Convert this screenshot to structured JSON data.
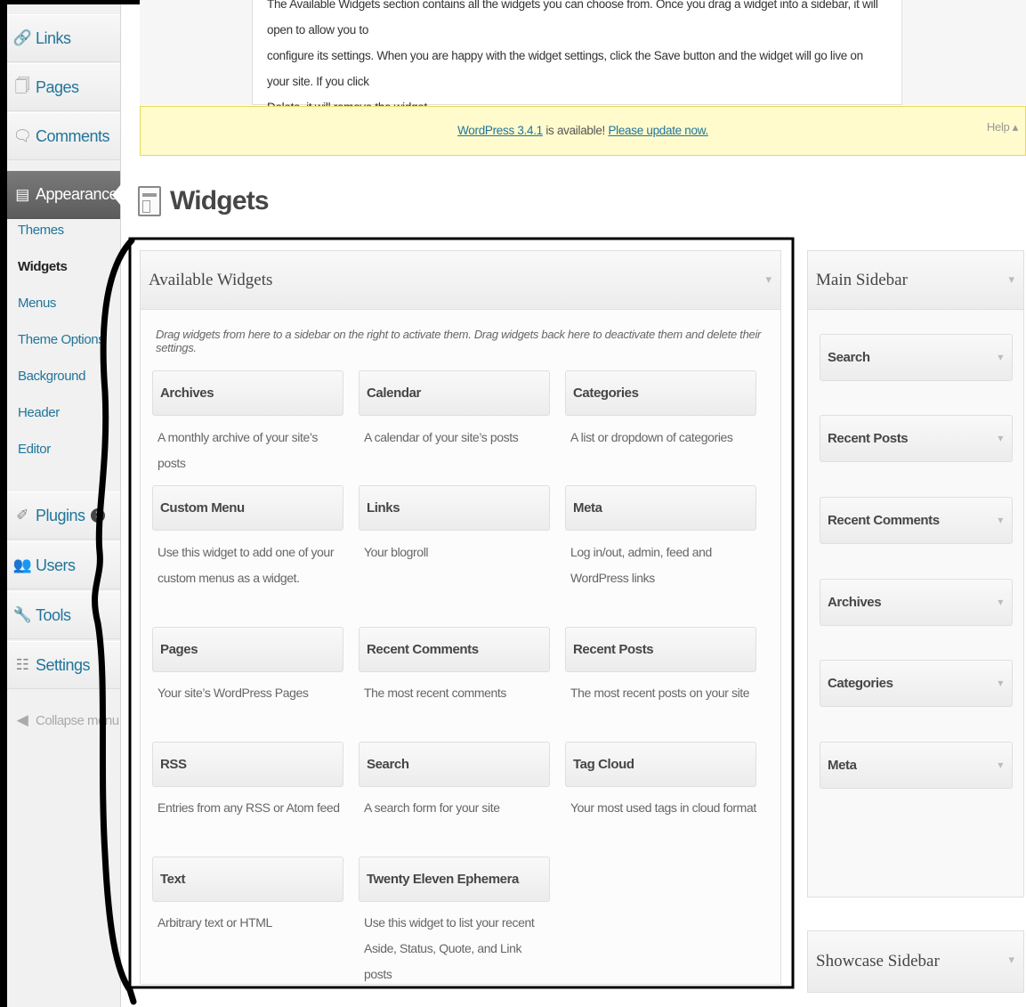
{
  "menu": {
    "links": "Links",
    "pages": "Pages",
    "comments": "Comments",
    "appearance": "Appearance",
    "submenu": [
      "Themes",
      "Widgets",
      "Menus",
      "Theme Options",
      "Background",
      "Header",
      "Editor"
    ],
    "plugins": "Plugins",
    "plugins_badge": "1",
    "users": "Users",
    "tools": "Tools",
    "settings": "Settings",
    "collapse": "Collapse menu"
  },
  "help": {
    "line1": "The Available Widgets section contains all the widgets you can choose from. Once you drag a widget into a sidebar, it will open to allow you to",
    "line2": "configure its settings. When you are happy with the widget settings, click the Save button and the widget will go live on your site. If you click",
    "line3": "Delete, it will remove the widget.",
    "tab": "Help ▴"
  },
  "update_nag": {
    "link1": "WordPress 3.4.1",
    "middle": " is available! ",
    "link2": "Please update now."
  },
  "page_title": "Widgets",
  "available": {
    "title": "Available Widgets",
    "description": "Drag widgets from here to a sidebar on the right to activate them. Drag widgets back here to deactivate them and delete their settings.",
    "widgets": [
      {
        "name": "Archives",
        "desc": "A monthly archive of your site’s posts"
      },
      {
        "name": "Calendar",
        "desc": "A calendar of your site’s posts"
      },
      {
        "name": "Categories",
        "desc": "A list or dropdown of categories"
      },
      {
        "name": "Custom Menu",
        "desc": "Use this widget to add one of your custom menus as a widget."
      },
      {
        "name": "Links",
        "desc": "Your blogroll"
      },
      {
        "name": "Meta",
        "desc": "Log in/out, admin, feed and WordPress links"
      },
      {
        "name": "Pages",
        "desc": "Your site’s WordPress Pages"
      },
      {
        "name": "Recent Comments",
        "desc": "The most recent comments"
      },
      {
        "name": "Recent Posts",
        "desc": "The most recent posts on your site"
      },
      {
        "name": "RSS",
        "desc": "Entries from any RSS or Atom feed"
      },
      {
        "name": "Search",
        "desc": "A search form for your site"
      },
      {
        "name": "Tag Cloud",
        "desc": "Your most used tags in cloud format"
      },
      {
        "name": "Text",
        "desc": "Arbitrary text or HTML"
      },
      {
        "name": "Twenty Eleven Ephemera",
        "desc": "Use this widget to list your recent Aside, Status, Quote, and Link posts"
      }
    ]
  },
  "main_sidebar": {
    "title": "Main Sidebar",
    "widgets": [
      "Search",
      "Recent Posts",
      "Recent Comments",
      "Archives",
      "Categories",
      "Meta"
    ]
  },
  "showcase_sidebar": {
    "title": "Showcase Sidebar"
  },
  "arrow_glyph": "▾"
}
